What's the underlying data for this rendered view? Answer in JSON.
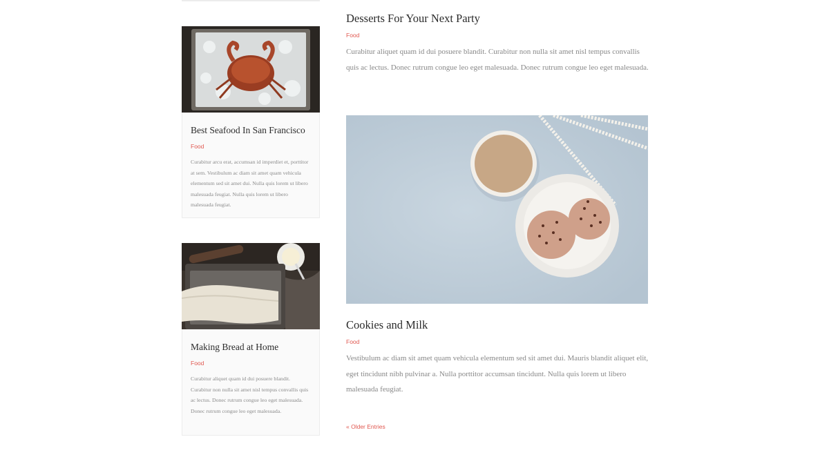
{
  "sidebar_posts": [
    {
      "title": "Best Seafood In San Francisco",
      "category": "Food",
      "excerpt": "Curabitur arcu erat, accumsan id imperdiet et, porttitor at sem. Vestibulum ac diam sit amet quam vehicula elementum sed sit amet dui. Nulla quis lorem ut libero malesuada feugiat. Nulla quis lorem ut libero malesuada feugiat.",
      "image": "crab-on-ice-photo"
    },
    {
      "title": "Making Bread at Home",
      "category": "Food",
      "excerpt": "Curabitur aliquet quam id dui posuere blandit. Curabitur non nulla sit amet nisl tempus convallis quis ac lectus. Donec rutrum congue leo eget malesuada. Donec rutrum congue leo eget malesuada.",
      "image": "bread-dough-photo"
    }
  ],
  "main_posts": [
    {
      "title": "Desserts For Your Next Party",
      "category": "Food",
      "excerpt": "Curabitur aliquet quam id dui posuere blandit. Curabitur non nulla sit amet nisl tempus convallis quis ac lectus. Donec rutrum congue leo eget malesuada. Donec rutrum congue leo eget malesuada."
    },
    {
      "title": "Cookies and Milk",
      "category": "Food",
      "excerpt": "Vestibulum ac diam sit amet quam vehicula elementum sed sit amet dui. Mauris blandit aliquet elit, eget tincidunt nibh pulvinar a. Nulla porttitor accumsan tincidunt. Nulla quis lorem ut libero malesuada feugiat.",
      "image": "coffee-and-cookies-photo"
    }
  ],
  "pagination": {
    "older_label": "« Older Entries"
  },
  "colors": {
    "accent": "#e0574f",
    "text": "#2b2b2b",
    "muted": "#888888",
    "card_bg": "#fafafa"
  }
}
